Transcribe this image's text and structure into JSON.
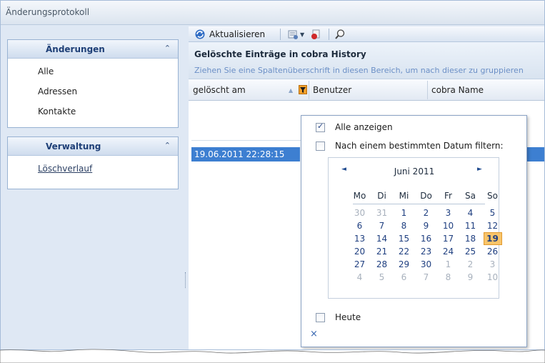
{
  "window": {
    "title": "Änderungsprotokoll"
  },
  "sidebar": {
    "groups": [
      {
        "title": "Änderungen",
        "items": [
          "Alle",
          "Adressen",
          "Kontakte"
        ]
      },
      {
        "title": "Verwaltung",
        "items": [
          "Löschverlauf"
        ]
      }
    ]
  },
  "toolbar": {
    "refresh_label": "Aktualisieren"
  },
  "panel": {
    "title": "Gelöschte Einträge in cobra History",
    "group_hint": "Ziehen Sie eine Spaltenüberschrift in diesen Bereich, um nach dieser zu gruppieren"
  },
  "grid": {
    "columns": [
      "gelöscht am",
      "Benutzer",
      "cobra Name"
    ],
    "selected_row": {
      "deleted_at": "19.06.2011 22:28:15"
    }
  },
  "filter_popup": {
    "show_all_label": "Alle anzeigen",
    "show_all_checked": true,
    "date_filter_label": "Nach einem bestimmten Datum filtern:",
    "date_filter_checked": false,
    "today_label": "Heute",
    "today_checked": false,
    "close_glyph": "×",
    "calendar": {
      "month_label": "Juni 2011",
      "prev_glyph": "◄",
      "next_glyph": "►",
      "weekdays": [
        "Mo",
        "Di",
        "Mi",
        "Do",
        "Fr",
        "Sa",
        "So"
      ],
      "weeks": [
        [
          "30",
          "31",
          "1",
          "2",
          "3",
          "4",
          "5"
        ],
        [
          "6",
          "7",
          "8",
          "9",
          "10",
          "11",
          "12"
        ],
        [
          "13",
          "14",
          "15",
          "16",
          "17",
          "18",
          "19"
        ],
        [
          "20",
          "21",
          "22",
          "23",
          "24",
          "25",
          "26"
        ],
        [
          "27",
          "28",
          "29",
          "30",
          "1",
          "2",
          "3"
        ],
        [
          "4",
          "5",
          "6",
          "7",
          "8",
          "9",
          "10"
        ]
      ],
      "highlighted_day": "19"
    }
  }
}
